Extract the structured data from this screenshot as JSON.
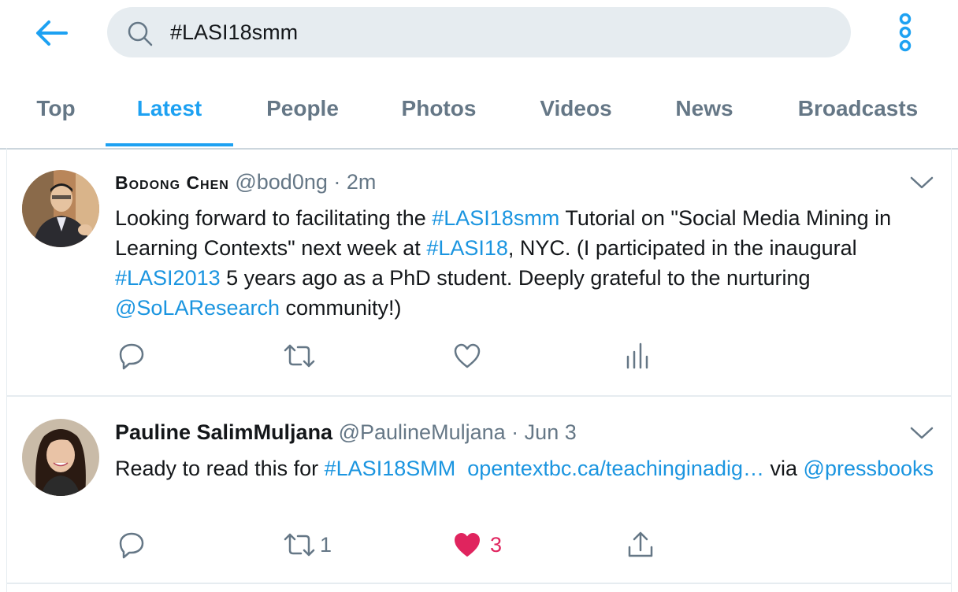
{
  "search": {
    "query": "#LASI18smm"
  },
  "tabs": [
    {
      "label": "Top",
      "active": false
    },
    {
      "label": "Latest",
      "active": true
    },
    {
      "label": "People",
      "active": false
    },
    {
      "label": "Photos",
      "active": false
    },
    {
      "label": "Videos",
      "active": false
    },
    {
      "label": "News",
      "active": false
    },
    {
      "label": "Broadcasts",
      "active": false
    }
  ],
  "colors": {
    "accent": "#1da1f2",
    "link": "#1b95e0",
    "muted": "#657786",
    "like": "#e0245e",
    "search_bg": "#e6ecf0"
  },
  "icons": [
    "back-arrow-icon",
    "search-icon",
    "more-vertical-icon",
    "chevron-down-icon",
    "reply-icon",
    "retweet-icon",
    "like-icon",
    "analytics-icon",
    "share-icon"
  ],
  "tweets": [
    {
      "name": "Bodong Chen",
      "handle": "@bod0ng",
      "dot": "·",
      "time": "2m",
      "text": {
        "t1": "Looking forward to facilitating the ",
        "h1": "#LASI18smm",
        "t2": " Tutorial on \"Social Media Mining in Learning Contexts\" next week at ",
        "h2": "#LASI18",
        "t3": ", NYC.  (I participated in the inaugural ",
        "h3": "#LASI2013",
        "t4": " 5 years ago as a PhD student. Deeply grateful to the nurturing ",
        "m1": "@SoLAResearch",
        "t5": " community!)"
      },
      "actions": {
        "replies": "",
        "retweets": "",
        "likes": "",
        "liked": false
      }
    },
    {
      "name": "Pauline SalimMuljana",
      "handle": "@PaulineMuljana",
      "dot": "·",
      "time": "Jun 3",
      "text": {
        "t1": "Ready to read this for ",
        "h1": "#LASI18SMM",
        "t2": "  ",
        "l1": "opentextbc.ca/teachinginadig…",
        "t3": " via ",
        "m1": "@pressbooks"
      },
      "actions": {
        "replies": "",
        "retweets": "1",
        "likes": "3",
        "liked": true
      }
    }
  ]
}
